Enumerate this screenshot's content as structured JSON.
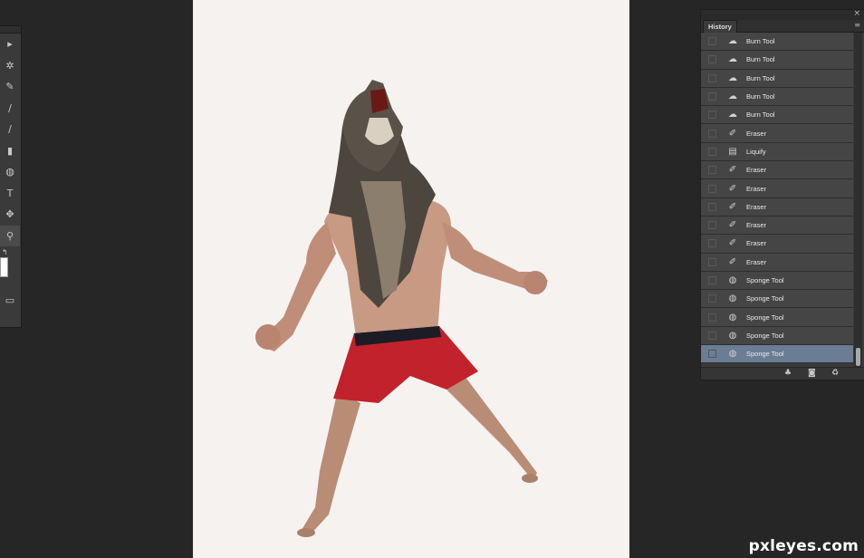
{
  "toolbar": {
    "tools": [
      {
        "name": "move-tool-icon",
        "glyph": "▸"
      },
      {
        "name": "magic-wand-icon",
        "glyph": "✲"
      },
      {
        "name": "eyedropper-icon",
        "glyph": "✎"
      },
      {
        "name": "brush-icon",
        "glyph": "∕"
      },
      {
        "name": "history-brush-icon",
        "glyph": "∕"
      },
      {
        "name": "gradient-icon",
        "glyph": "▮"
      },
      {
        "name": "sponge-icon",
        "glyph": "◍"
      },
      {
        "name": "type-tool-icon",
        "glyph": "T"
      },
      {
        "name": "custom-shape-icon",
        "glyph": "✥"
      },
      {
        "name": "zoom-tool-icon",
        "glyph": "⚲"
      }
    ],
    "swap_glyph": "↰",
    "screen_mode_glyph": "▭"
  },
  "history": {
    "title": "History",
    "close_glyph": "×",
    "menu_glyph": "≡",
    "items": [
      {
        "label": "Burn Tool",
        "icon": "burn-icon",
        "glyph": "☁"
      },
      {
        "label": "Burn Tool",
        "icon": "burn-icon",
        "glyph": "☁"
      },
      {
        "label": "Burn Tool",
        "icon": "burn-icon",
        "glyph": "☁"
      },
      {
        "label": "Burn Tool",
        "icon": "burn-icon",
        "glyph": "☁"
      },
      {
        "label": "Burn Tool",
        "icon": "burn-icon",
        "glyph": "☁"
      },
      {
        "label": "Eraser",
        "icon": "eraser-icon",
        "glyph": "✐"
      },
      {
        "label": "Liquify",
        "icon": "liquify-icon",
        "glyph": "▤"
      },
      {
        "label": "Eraser",
        "icon": "eraser-icon",
        "glyph": "✐"
      },
      {
        "label": "Eraser",
        "icon": "eraser-icon",
        "glyph": "✐"
      },
      {
        "label": "Eraser",
        "icon": "eraser-icon",
        "glyph": "✐"
      },
      {
        "label": "Eraser",
        "icon": "eraser-icon",
        "glyph": "✐"
      },
      {
        "label": "Eraser",
        "icon": "eraser-icon",
        "glyph": "✐"
      },
      {
        "label": "Eraser",
        "icon": "eraser-icon",
        "glyph": "✐"
      },
      {
        "label": "Sponge Tool",
        "icon": "sponge-icon",
        "glyph": "◍"
      },
      {
        "label": "Sponge Tool",
        "icon": "sponge-icon",
        "glyph": "◍"
      },
      {
        "label": "Sponge Tool",
        "icon": "sponge-icon",
        "glyph": "◍"
      },
      {
        "label": "Sponge Tool",
        "icon": "sponge-icon",
        "glyph": "◍"
      },
      {
        "label": "Sponge Tool",
        "icon": "sponge-icon",
        "glyph": "◍",
        "selected": true
      }
    ],
    "footer": [
      {
        "name": "new-document-from-state-icon",
        "glyph": "♣"
      },
      {
        "name": "new-snapshot-icon",
        "glyph": "◙"
      },
      {
        "name": "delete-state-icon",
        "glyph": "♻"
      }
    ]
  },
  "watermark": "pxleyes.com",
  "colors": {
    "workspace": "#262626",
    "canvas": "#f6f2f0",
    "panel": "#3b3b3b",
    "selected_row": "#6b7d95",
    "shorts": "#c2222b"
  }
}
